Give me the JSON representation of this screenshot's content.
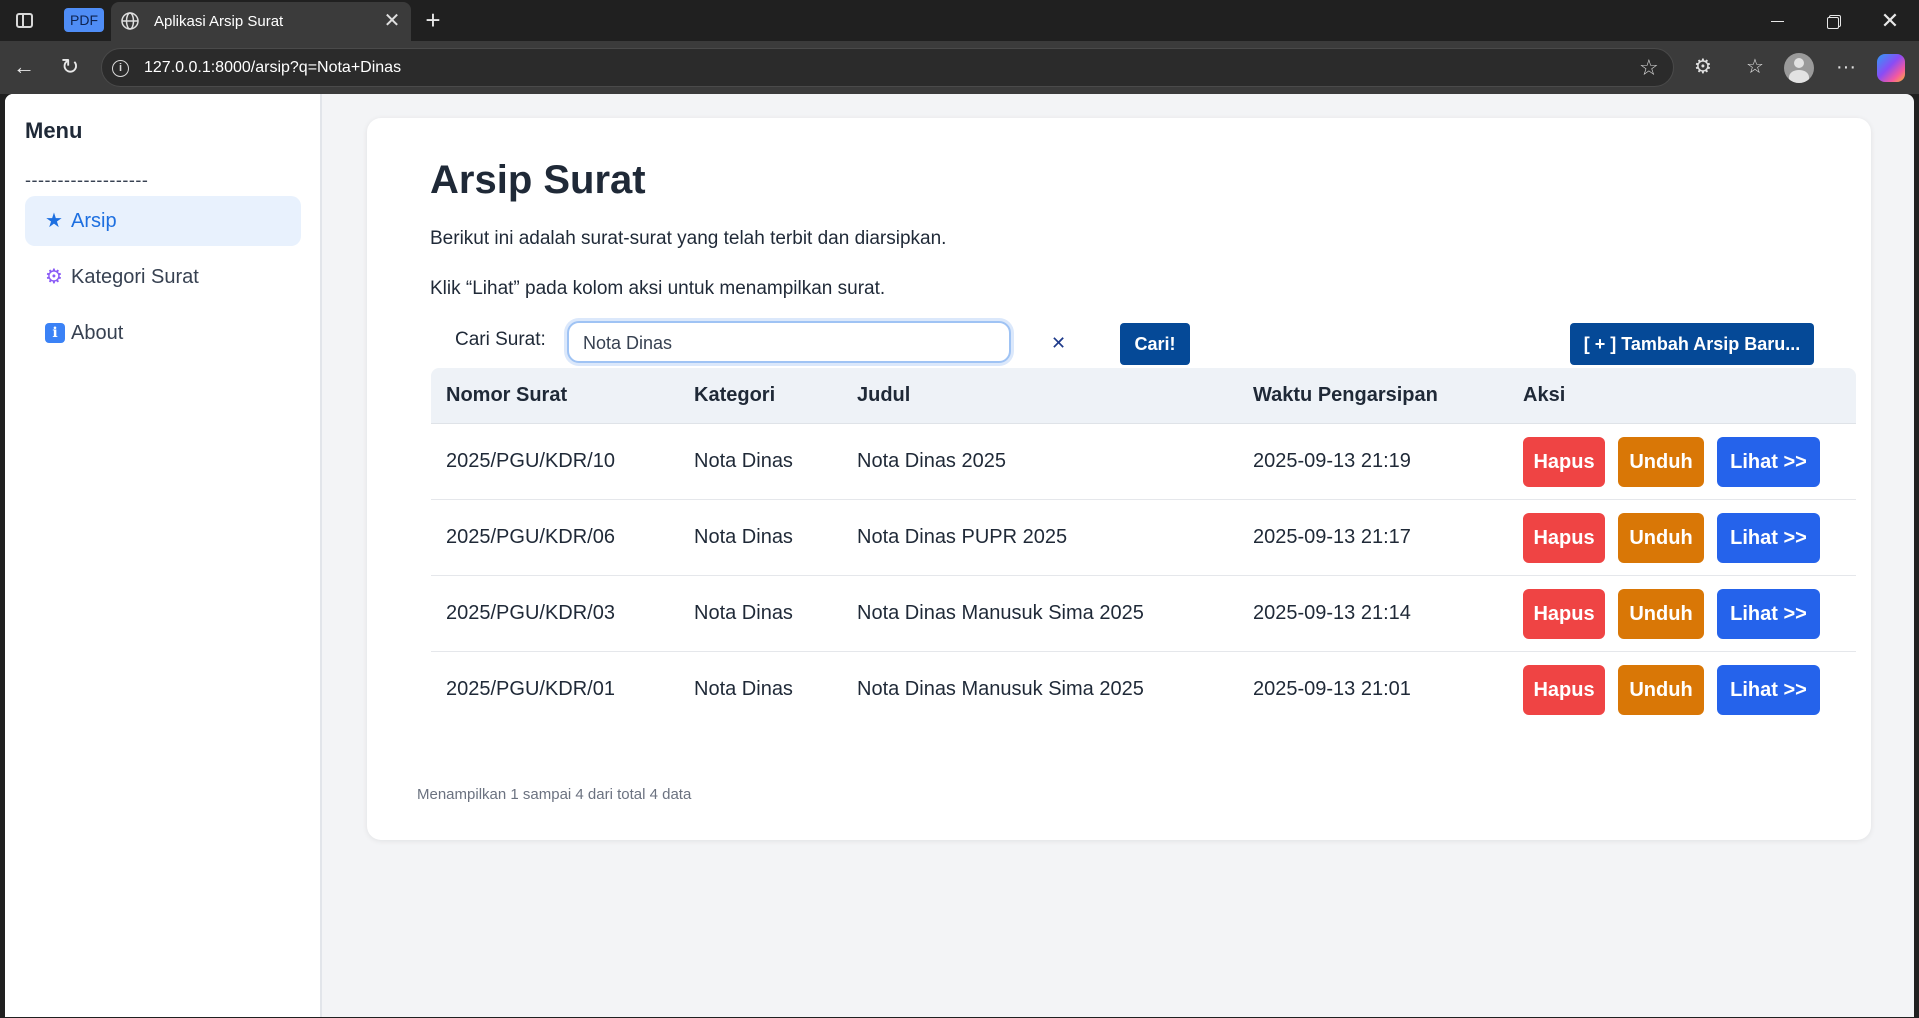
{
  "browser": {
    "pdf_badge": "PDF",
    "tab_title": "Aplikasi Arsip Surat",
    "url": "127.0.0.1:8000/arsip?q=Nota+Dinas"
  },
  "sidebar": {
    "title": "Menu",
    "separator": "-------------------",
    "items": [
      {
        "icon": "★",
        "label": "Arsip",
        "active": true
      },
      {
        "icon": "⚙",
        "label": "Kategori Surat",
        "active": false
      },
      {
        "icon": "i",
        "label": "About",
        "active": false
      }
    ]
  },
  "main": {
    "title": "Arsip Surat",
    "desc1": "Berikut ini adalah surat-surat yang telah terbit dan diarsipkan.",
    "desc2": "Klik “Lihat” pada kolom aksi untuk menampilkan surat.",
    "search": {
      "label": "Cari Surat:",
      "value": "Nota Dinas",
      "button": "Cari!"
    },
    "add_button": "[ + ] Tambah Arsip Baru...",
    "table": {
      "headers": [
        "Nomor Surat",
        "Kategori",
        "Judul",
        "Waktu Pengarsipan",
        "Aksi"
      ],
      "rows": [
        {
          "nomor": "2025/PGU/KDR/10",
          "kategori": "Nota Dinas",
          "judul": "Nota Dinas 2025",
          "waktu": "2025-09-13 21:19"
        },
        {
          "nomor": "2025/PGU/KDR/06",
          "kategori": "Nota Dinas",
          "judul": "Nota Dinas PUPR 2025",
          "waktu": "2025-09-13 21:17"
        },
        {
          "nomor": "2025/PGU/KDR/03",
          "kategori": "Nota Dinas",
          "judul": "Nota Dinas Manusuk Sima 2025",
          "waktu": "2025-09-13 21:14"
        },
        {
          "nomor": "2025/PGU/KDR/01",
          "kategori": "Nota Dinas",
          "judul": "Nota Dinas Manusuk Sima 2025",
          "waktu": "2025-09-13 21:01"
        }
      ],
      "actions": {
        "delete": "Hapus",
        "download": "Unduh",
        "view": "Lihat >>"
      }
    },
    "footer": "Menampilkan 1 sampai 4 dari total 4 data"
  },
  "colors": {
    "primary_button": "#054997",
    "delete": "#ef4444",
    "download": "#d97706",
    "view": "#2563eb",
    "active_menu_bg": "#e8f1fd"
  }
}
